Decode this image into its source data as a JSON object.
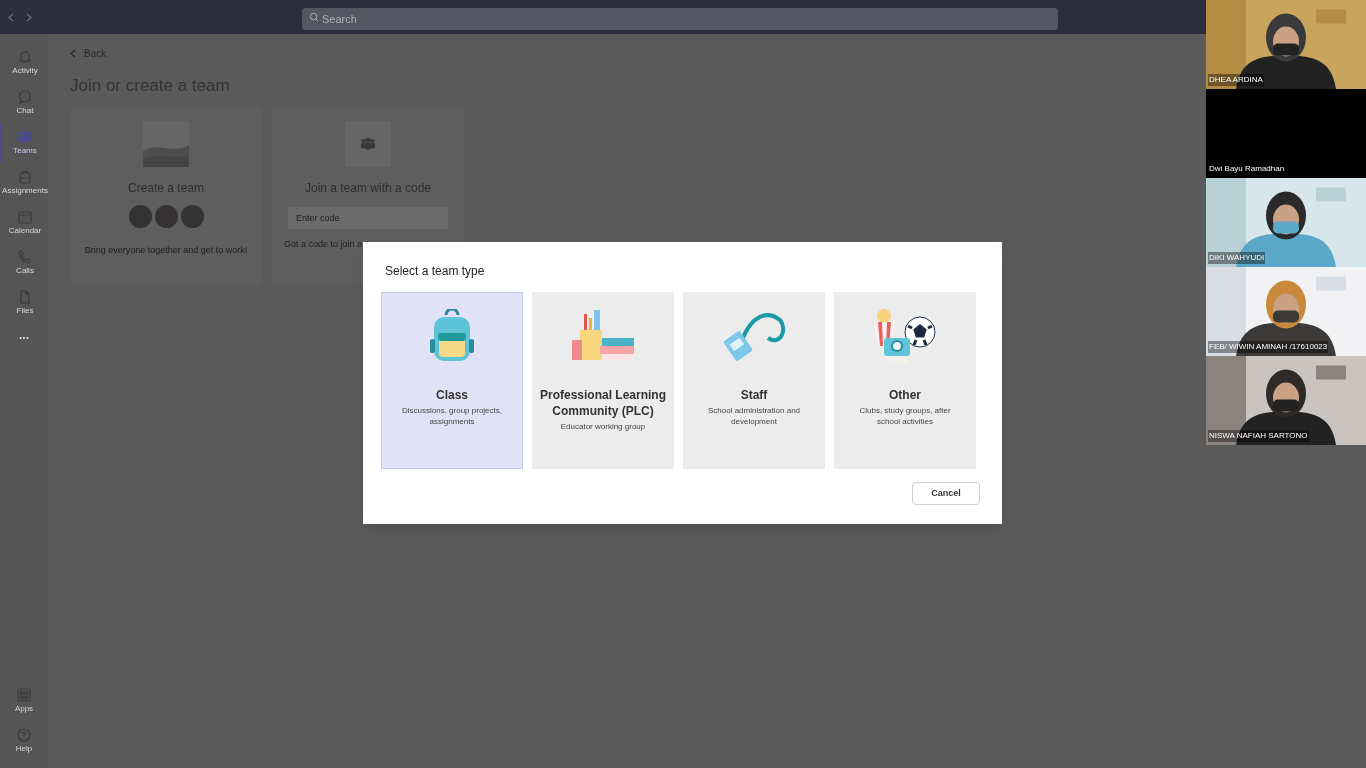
{
  "top_bar": {
    "search_placeholder": "Search"
  },
  "sidebar": {
    "items": [
      {
        "label": "Activity",
        "selected": false
      },
      {
        "label": "Chat",
        "selected": false
      },
      {
        "label": "Teams",
        "selected": true
      },
      {
        "label": "Assignments",
        "selected": false
      },
      {
        "label": "Calendar",
        "selected": false
      },
      {
        "label": "Calls",
        "selected": false
      },
      {
        "label": "Files",
        "selected": false
      }
    ],
    "more": "...",
    "bottom_items": [
      {
        "label": "Apps"
      },
      {
        "label": "Help"
      }
    ]
  },
  "page": {
    "back": "Back",
    "title": "Join or create a team",
    "cards": [
      {
        "kind": "create",
        "title": "Create a team",
        "description": "Bring everyone together and get to work!"
      },
      {
        "kind": "join",
        "title": "Join a team with a code",
        "placeholder": "Enter code",
        "description": "Got a code to join a"
      }
    ]
  },
  "dialog": {
    "title": "Select a team type",
    "options": [
      {
        "title": "Class",
        "description": "Discussions, group projects, assignments",
        "selected": true
      },
      {
        "title": "Professional Learning Community (PLC)",
        "description": "Educator working group",
        "selected": false
      },
      {
        "title": "Staff",
        "description": "School administration and development",
        "selected": false
      },
      {
        "title": "Other",
        "description": "Clubs, study groups, after school activities",
        "selected": false
      }
    ],
    "cancel": "Cancel"
  },
  "participants": [
    {
      "name": "DHEA ARDINA",
      "camera_on": true
    },
    {
      "name": "Dwi Bayu Ramadhan",
      "camera_on": false
    },
    {
      "name": "DIKI WAHYUDI",
      "camera_on": true
    },
    {
      "name": "FEB/ WIWIN AMINAH /17610023",
      "camera_on": true
    },
    {
      "name": "NISWA NAFIAH SARTONO",
      "camera_on": true
    }
  ]
}
